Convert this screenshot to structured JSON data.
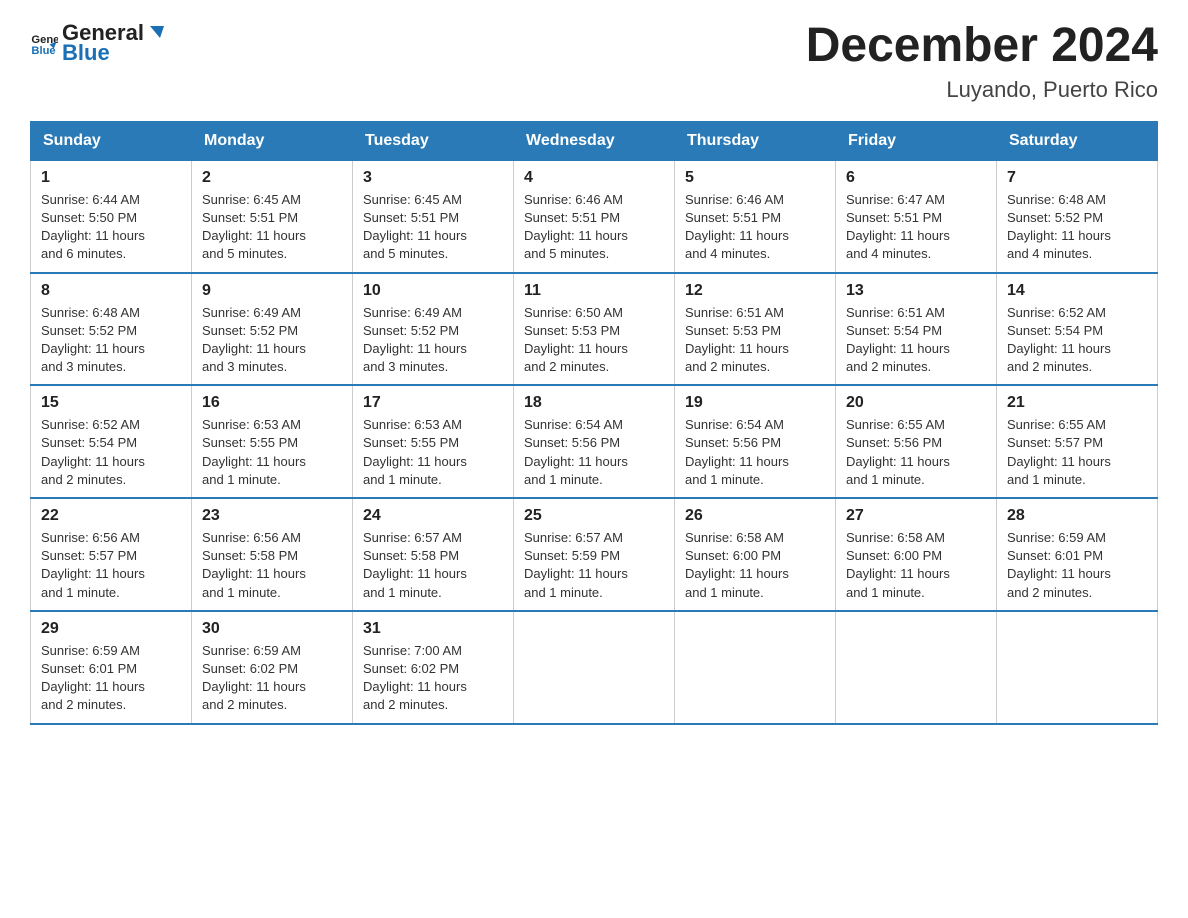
{
  "header": {
    "logo_general": "General",
    "logo_blue": "Blue",
    "title": "December 2024",
    "subtitle": "Luyando, Puerto Rico"
  },
  "days_of_week": [
    "Sunday",
    "Monday",
    "Tuesday",
    "Wednesday",
    "Thursday",
    "Friday",
    "Saturday"
  ],
  "weeks": [
    [
      {
        "day": "1",
        "sunrise": "6:44 AM",
        "sunset": "5:50 PM",
        "daylight": "11 hours and 6 minutes."
      },
      {
        "day": "2",
        "sunrise": "6:45 AM",
        "sunset": "5:51 PM",
        "daylight": "11 hours and 5 minutes."
      },
      {
        "day": "3",
        "sunrise": "6:45 AM",
        "sunset": "5:51 PM",
        "daylight": "11 hours and 5 minutes."
      },
      {
        "day": "4",
        "sunrise": "6:46 AM",
        "sunset": "5:51 PM",
        "daylight": "11 hours and 5 minutes."
      },
      {
        "day": "5",
        "sunrise": "6:46 AM",
        "sunset": "5:51 PM",
        "daylight": "11 hours and 4 minutes."
      },
      {
        "day": "6",
        "sunrise": "6:47 AM",
        "sunset": "5:51 PM",
        "daylight": "11 hours and 4 minutes."
      },
      {
        "day": "7",
        "sunrise": "6:48 AM",
        "sunset": "5:52 PM",
        "daylight": "11 hours and 4 minutes."
      }
    ],
    [
      {
        "day": "8",
        "sunrise": "6:48 AM",
        "sunset": "5:52 PM",
        "daylight": "11 hours and 3 minutes."
      },
      {
        "day": "9",
        "sunrise": "6:49 AM",
        "sunset": "5:52 PM",
        "daylight": "11 hours and 3 minutes."
      },
      {
        "day": "10",
        "sunrise": "6:49 AM",
        "sunset": "5:52 PM",
        "daylight": "11 hours and 3 minutes."
      },
      {
        "day": "11",
        "sunrise": "6:50 AM",
        "sunset": "5:53 PM",
        "daylight": "11 hours and 2 minutes."
      },
      {
        "day": "12",
        "sunrise": "6:51 AM",
        "sunset": "5:53 PM",
        "daylight": "11 hours and 2 minutes."
      },
      {
        "day": "13",
        "sunrise": "6:51 AM",
        "sunset": "5:54 PM",
        "daylight": "11 hours and 2 minutes."
      },
      {
        "day": "14",
        "sunrise": "6:52 AM",
        "sunset": "5:54 PM",
        "daylight": "11 hours and 2 minutes."
      }
    ],
    [
      {
        "day": "15",
        "sunrise": "6:52 AM",
        "sunset": "5:54 PM",
        "daylight": "11 hours and 2 minutes."
      },
      {
        "day": "16",
        "sunrise": "6:53 AM",
        "sunset": "5:55 PM",
        "daylight": "11 hours and 1 minute."
      },
      {
        "day": "17",
        "sunrise": "6:53 AM",
        "sunset": "5:55 PM",
        "daylight": "11 hours and 1 minute."
      },
      {
        "day": "18",
        "sunrise": "6:54 AM",
        "sunset": "5:56 PM",
        "daylight": "11 hours and 1 minute."
      },
      {
        "day": "19",
        "sunrise": "6:54 AM",
        "sunset": "5:56 PM",
        "daylight": "11 hours and 1 minute."
      },
      {
        "day": "20",
        "sunrise": "6:55 AM",
        "sunset": "5:56 PM",
        "daylight": "11 hours and 1 minute."
      },
      {
        "day": "21",
        "sunrise": "6:55 AM",
        "sunset": "5:57 PM",
        "daylight": "11 hours and 1 minute."
      }
    ],
    [
      {
        "day": "22",
        "sunrise": "6:56 AM",
        "sunset": "5:57 PM",
        "daylight": "11 hours and 1 minute."
      },
      {
        "day": "23",
        "sunrise": "6:56 AM",
        "sunset": "5:58 PM",
        "daylight": "11 hours and 1 minute."
      },
      {
        "day": "24",
        "sunrise": "6:57 AM",
        "sunset": "5:58 PM",
        "daylight": "11 hours and 1 minute."
      },
      {
        "day": "25",
        "sunrise": "6:57 AM",
        "sunset": "5:59 PM",
        "daylight": "11 hours and 1 minute."
      },
      {
        "day": "26",
        "sunrise": "6:58 AM",
        "sunset": "6:00 PM",
        "daylight": "11 hours and 1 minute."
      },
      {
        "day": "27",
        "sunrise": "6:58 AM",
        "sunset": "6:00 PM",
        "daylight": "11 hours and 1 minute."
      },
      {
        "day": "28",
        "sunrise": "6:59 AM",
        "sunset": "6:01 PM",
        "daylight": "11 hours and 2 minutes."
      }
    ],
    [
      {
        "day": "29",
        "sunrise": "6:59 AM",
        "sunset": "6:01 PM",
        "daylight": "11 hours and 2 minutes."
      },
      {
        "day": "30",
        "sunrise": "6:59 AM",
        "sunset": "6:02 PM",
        "daylight": "11 hours and 2 minutes."
      },
      {
        "day": "31",
        "sunrise": "7:00 AM",
        "sunset": "6:02 PM",
        "daylight": "11 hours and 2 minutes."
      },
      null,
      null,
      null,
      null
    ]
  ],
  "labels": {
    "sunrise": "Sunrise:",
    "sunset": "Sunset:",
    "daylight": "Daylight:"
  }
}
